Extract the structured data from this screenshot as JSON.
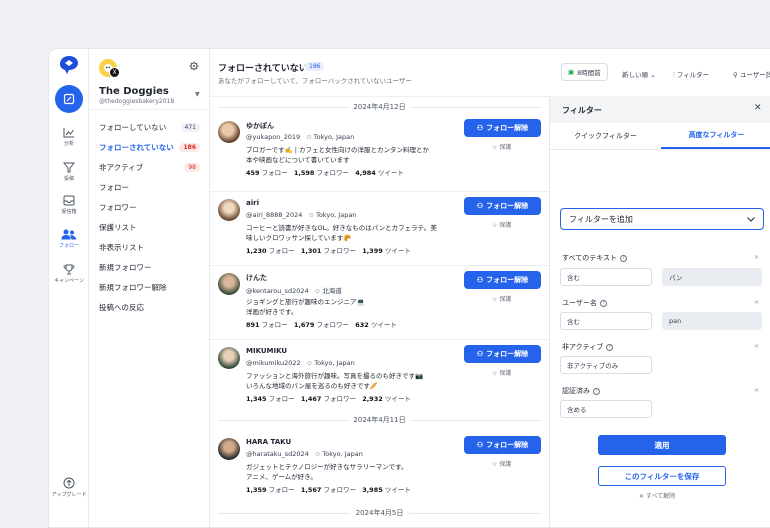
{
  "rail": {
    "items": [
      {
        "label": "分析",
        "icon": "chart-icon"
      },
      {
        "label": "投稿",
        "icon": "send-icon"
      },
      {
        "label": "受信箱",
        "icon": "inbox-icon"
      },
      {
        "label": "フォロー",
        "icon": "users-icon"
      },
      {
        "label": "キャンペーン",
        "icon": "trophy-icon"
      },
      {
        "label": "アップグレード",
        "icon": "upgrade-icon"
      }
    ]
  },
  "account": {
    "name": "The Doggies",
    "handle": "@thedoggiesbakery2018",
    "badge": "X"
  },
  "nav": [
    {
      "label": "フォローしていない",
      "count": "471"
    },
    {
      "label": "フォローされていない",
      "count": "186"
    },
    {
      "label": "非アクティブ",
      "count": "98"
    },
    {
      "label": "フォロー",
      "count": ""
    },
    {
      "label": "フォロワー",
      "count": ""
    },
    {
      "label": "保護リスト",
      "count": ""
    },
    {
      "label": "非表示リスト",
      "count": ""
    },
    {
      "label": "新規フォロワー",
      "count": ""
    },
    {
      "label": "新規フォロワー解除",
      "count": ""
    },
    {
      "label": "投稿への反応",
      "count": ""
    }
  ],
  "main": {
    "title": "フォローされていない",
    "count": "186",
    "subtitle": "あなたがフォローしていて、フォローバックされていないユーザー",
    "dates": [
      "2024年4月12日",
      "2024年4月11日",
      "2024年4月5日"
    ]
  },
  "tools": {
    "time": "8時間前",
    "sort": "新しい順",
    "filter": "フィルター",
    "details": "ユーザー詳細",
    "more": "···"
  },
  "cards": [
    {
      "name": "ゆかぽん",
      "handle": "@yukapon_2019",
      "location": "Tokyo, Japan",
      "bio": [
        "ブロガーです✍️ | カフェと女性向けの洋服とカンタン料理とか",
        "本や映画などについて書いています"
      ],
      "following": "459",
      "followers": "1,598",
      "tweets": "4,984"
    },
    {
      "name": "airi",
      "handle": "@airi_8888_2024",
      "location": "Tokyo, Japan",
      "bio": [
        " コーヒーと読書が好きなOL。好きなものはパンとカフェラテ。美",
        "味しいクロワッサン探しています🥐"
      ],
      "following": "1,230",
      "followers": "1,301",
      "tweets": "1,399"
    },
    {
      "name": "けんた",
      "handle": "@kentarou_sd2024",
      "location": "北海道",
      "bio": [
        "ジョギングと旅行が趣味のエンジニア💻",
        "洋画が好きです。"
      ],
      "following": "891",
      "followers": "1,679",
      "tweets": "632"
    },
    {
      "name": "MIKUMIKU",
      "handle": "@mikumiku2022",
      "location": "Tokyo, Japan",
      "bio": [
        "ファッションと海外旅行が趣味。写真を撮るのも好きです📷",
        "いろんな地域のパン屋を巡るのも好きです🥖"
      ],
      "following": "1,345",
      "followers": "1,467",
      "tweets": "2,932"
    },
    {
      "name": "HARA TAKU",
      "handle": "@harataku_sd2024",
      "location": "Tokyo, Japan",
      "bio": [
        "ガジェットとテクノロジーが好きなサラリーマンです。",
        "アニメ、ゲームが好き。"
      ],
      "following": "1,359",
      "followers": "1,567",
      "tweets": "3,985"
    }
  ],
  "labels": {
    "unfollow": "フォロー解除",
    "protect": "保護",
    "following_suffix": "フォロー",
    "followers_suffix": "フォロワー",
    "tweets_suffix": "ツイート"
  },
  "panel": {
    "title": "フィルター",
    "tab_quick": "クイックフィルター",
    "tab_advanced": "高度なフィルター",
    "add_filter": "フィルターを追加",
    "filters": [
      {
        "label": "すべてのテキスト",
        "op": "含む",
        "value": "パン"
      },
      {
        "label": "ユーザー名",
        "op": "含む",
        "value": "pan"
      },
      {
        "label": "非アクティブ",
        "op": "非アクティブのみ",
        "value": ""
      },
      {
        "label": "認証済み",
        "op": "含める",
        "value": ""
      }
    ],
    "apply": "適用",
    "save": "このフィルターを保存",
    "clear_all": "✕ すべて解除"
  }
}
